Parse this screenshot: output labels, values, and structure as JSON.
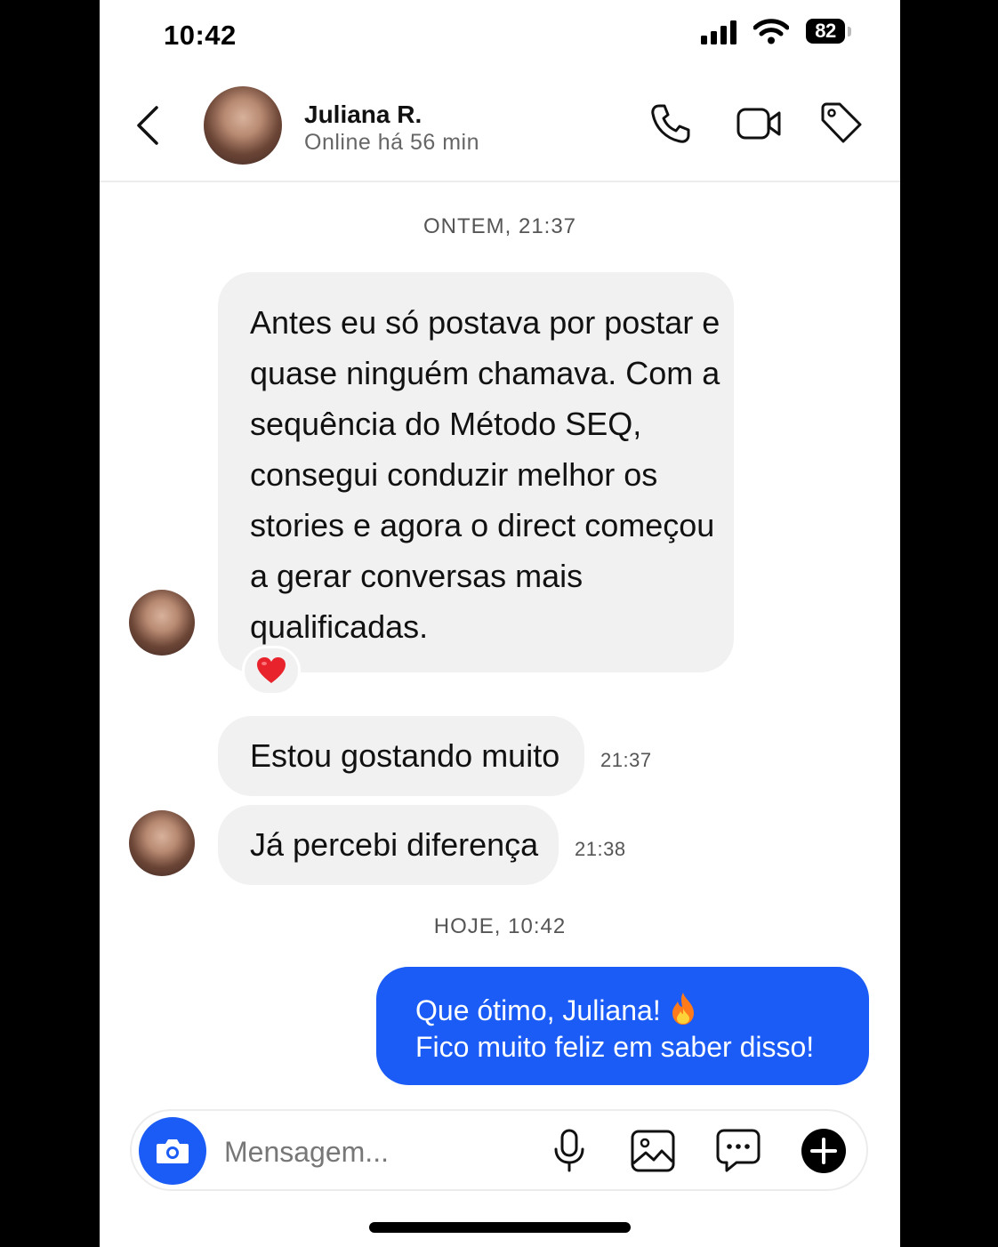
{
  "status_bar": {
    "time": "10:42",
    "battery": "82",
    "icons": [
      "cellular-signal-icon",
      "wifi-icon",
      "battery-icon"
    ]
  },
  "header": {
    "back_icon": "chevron-left-icon",
    "contact_name": "Juliana R.",
    "contact_status": "Online há 56 min",
    "actions": [
      "phone-icon",
      "video-call-icon",
      "tag-icon"
    ]
  },
  "conversation": {
    "separators": {
      "yesterday": "ONTEM, 21:37",
      "today": "HOJE, 10:42"
    },
    "messages": [
      {
        "direction": "incoming",
        "text": "Antes eu só postava por postar e quase ninguém chamava. Com a sequência do Método SEQ, consegui conduzir melhor os stories e agora o direct começou a gerar conversas mais qualificadas.",
        "reaction": "heart-icon"
      },
      {
        "direction": "incoming",
        "text": "Estou gostando muito",
        "time": "21:37"
      },
      {
        "direction": "incoming",
        "text": "Já percebi diferença",
        "time": "21:38"
      },
      {
        "direction": "outgoing",
        "line1": "Que ótimo, Juliana!",
        "line1_emoji": "fire-icon",
        "line2": "Fico muito feliz em saber disso!"
      }
    ]
  },
  "composer": {
    "placeholder": "Mensagem...",
    "icons": [
      "camera-icon",
      "microphone-icon",
      "gallery-icon",
      "sticker-chat-icon",
      "plus-icon"
    ]
  },
  "colors": {
    "accent": "#1a5cf5",
    "incoming_bubble": "#f1f1f1",
    "background": "#ffffff"
  }
}
